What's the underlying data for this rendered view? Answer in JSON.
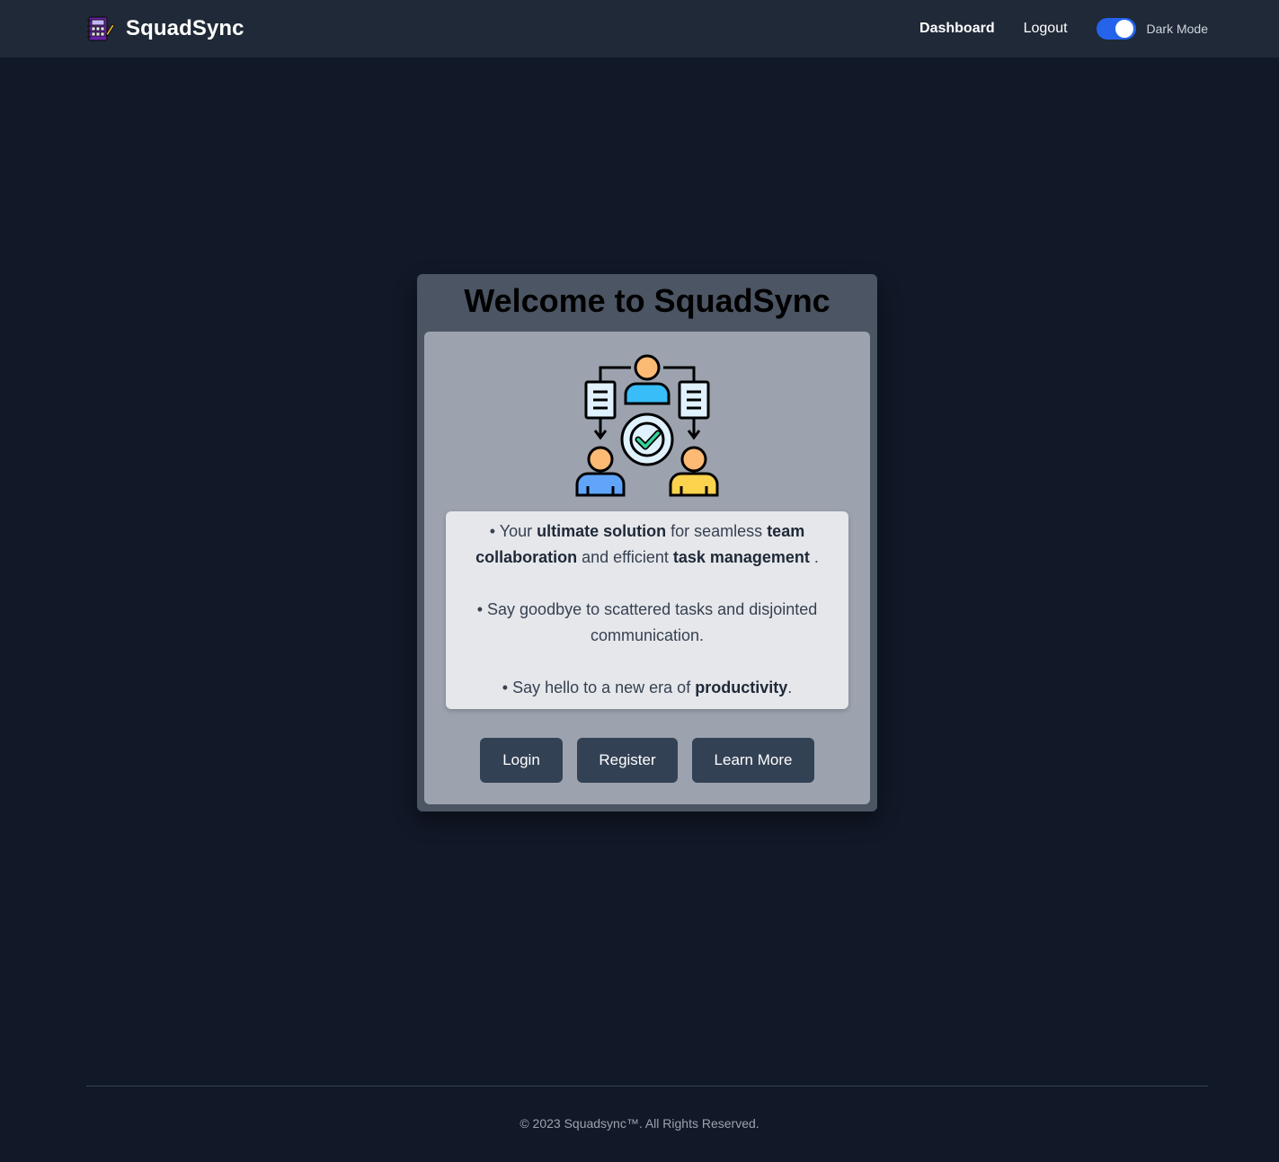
{
  "nav": {
    "brand": "SquadSync",
    "brand_icon": "planner-board-icon",
    "links": {
      "dashboard": "Dashboard",
      "logout": "Logout"
    },
    "dark_mode_label": "Dark Mode",
    "dark_mode_on": true
  },
  "hero": {
    "title": "Welcome to SquadSync",
    "illustration": "team-collaboration-icon",
    "line1": {
      "p1": "• Your ",
      "b1": "ultimate solution",
      "p2": " for seamless ",
      "b2": "team collaboration",
      "p3": " and efficient ",
      "b3": "task management",
      "p4": " ."
    },
    "line2": "• Say goodbye to scattered tasks and disjointed communication.",
    "line3": {
      "p1": "• Say hello to a new era of ",
      "b1": "productivity",
      "p2": "."
    }
  },
  "buttons": {
    "login": "Login",
    "register": "Register",
    "learn_more": "Learn More"
  },
  "footer": {
    "text": "© 2023 Squadsync™. All Rights Reserved."
  },
  "colors": {
    "background": "#111827",
    "navbar": "#1f2937",
    "toggle": "#2563eb",
    "button": "#334155"
  }
}
